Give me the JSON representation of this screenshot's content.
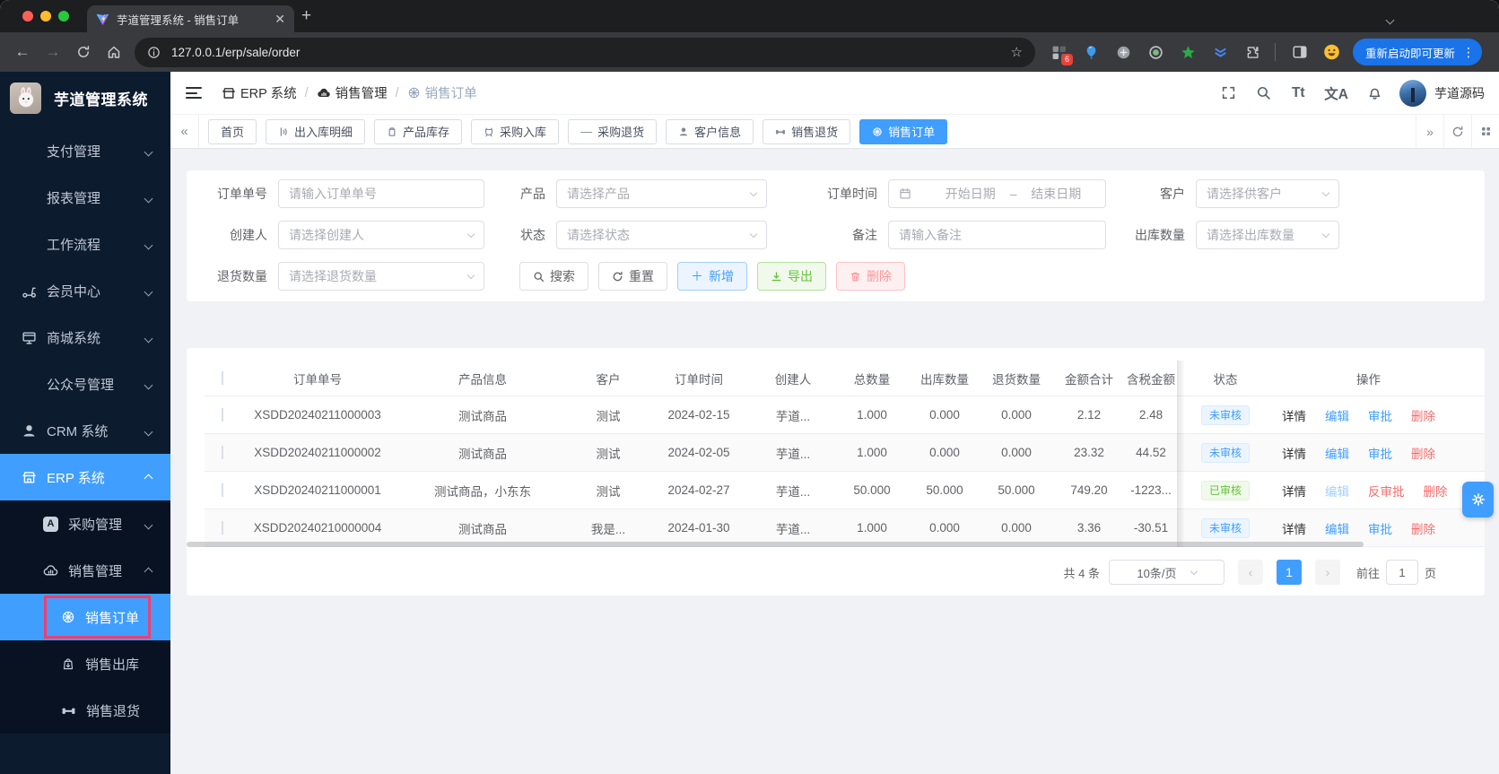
{
  "browser": {
    "tab_title": "芋道管理系统 - 销售订单",
    "url": "127.0.0.1/erp/sale/order",
    "update_label": "重新启动即可更新",
    "ext_badge": "6"
  },
  "sidebar": {
    "logo_title": "芋道管理系统",
    "items": [
      {
        "label": "支付管理"
      },
      {
        "label": "报表管理"
      },
      {
        "label": "工作流程"
      },
      {
        "label": "会员中心"
      },
      {
        "label": "商城系统"
      },
      {
        "label": "公众号管理"
      },
      {
        "label": "CRM 系统"
      },
      {
        "label": "ERP 系统"
      },
      {
        "label": "采购管理"
      },
      {
        "label": "销售管理"
      },
      {
        "label": "销售订单"
      },
      {
        "label": "销售出库"
      },
      {
        "label": "销售退货"
      }
    ]
  },
  "header": {
    "breadcrumb": [
      {
        "label": "ERP 系统"
      },
      {
        "label": "销售管理"
      },
      {
        "label": "销售订单"
      }
    ],
    "font_button": "Tt",
    "lang_button": "文A",
    "username": "芋道源码"
  },
  "tabs": [
    {
      "label": "首页"
    },
    {
      "label": "出入库明细"
    },
    {
      "label": "产品库存"
    },
    {
      "label": "采购入库"
    },
    {
      "label": "采购退货"
    },
    {
      "label": "客户信息"
    },
    {
      "label": "销售退货"
    },
    {
      "label": "销售订单"
    }
  ],
  "filters": {
    "order_no": {
      "label": "订单单号",
      "placeholder": "请输入订单单号"
    },
    "product": {
      "label": "产品",
      "placeholder": "请选择产品"
    },
    "order_time": {
      "label": "订单时间",
      "start": "开始日期",
      "separator": "–",
      "end": "结束日期"
    },
    "customer": {
      "label": "客户",
      "placeholder": "请选择供客户"
    },
    "creator": {
      "label": "创建人",
      "placeholder": "请选择创建人"
    },
    "status": {
      "label": "状态",
      "placeholder": "请选择状态"
    },
    "remark": {
      "label": "备注",
      "placeholder": "请输入备注"
    },
    "out_count": {
      "label": "出库数量",
      "placeholder": "请选择出库数量"
    },
    "return_count": {
      "label": "退货数量",
      "placeholder": "请选择退货数量"
    }
  },
  "toolbar": {
    "search_label": "搜索",
    "reset_label": "重置",
    "add_label": "新增",
    "export_label": "导出",
    "delete_label": "删除"
  },
  "table": {
    "columns": [
      "订单单号",
      "产品信息",
      "客户",
      "订单时间",
      "创建人",
      "总数量",
      "出库数量",
      "退货数量",
      "金额合计",
      "含税金额",
      "状态",
      "操作"
    ],
    "rows": [
      {
        "order_no": "XSDD20240211000003",
        "product": "测试商品",
        "customer": "测试",
        "time": "2024-02-15",
        "creator": "芋道...",
        "total": "1.000",
        "out": "0.000",
        "ret": "0.000",
        "amount": "2.12",
        "tax": "2.48",
        "status": "未审核",
        "actions": [
          "详情",
          "编辑",
          "审批",
          "删除"
        ]
      },
      {
        "order_no": "XSDD20240211000002",
        "product": "测试商品",
        "customer": "测试",
        "time": "2024-02-05",
        "creator": "芋道...",
        "total": "1.000",
        "out": "0.000",
        "ret": "0.000",
        "amount": "23.32",
        "tax": "44.52",
        "status": "未审核",
        "actions": [
          "详情",
          "编辑",
          "审批",
          "删除"
        ]
      },
      {
        "order_no": "XSDD20240211000001",
        "product": "测试商品，小东东",
        "customer": "测试",
        "time": "2024-02-27",
        "creator": "芋道...",
        "total": "50.000",
        "out": "50.000",
        "ret": "50.000",
        "amount": "749.20",
        "tax": "-1223...",
        "status": "已审核",
        "actions": [
          "详情",
          "编辑",
          "反审批",
          "删除"
        ]
      },
      {
        "order_no": "XSDD20240210000004",
        "product": "测试商品",
        "customer": "我是...",
        "time": "2024-01-30",
        "creator": "芋道...",
        "total": "1.000",
        "out": "0.000",
        "ret": "0.000",
        "amount": "3.36",
        "tax": "-30.51",
        "status": "未审核",
        "actions": [
          "详情",
          "编辑",
          "审批",
          "删除"
        ]
      }
    ]
  },
  "pagination": {
    "total": "共 4 条",
    "page_size": "10条/页",
    "page": "1",
    "goto_label": "前往",
    "goto_value": "1",
    "unit": "页"
  },
  "colors": {
    "accent": "#409eff",
    "success": "#67c23a",
    "danger": "#f56c6c",
    "sidebar_bg": "#0d1b2e",
    "highlight_border": "#f23d6b",
    "status_unapproved_bg": "#ecf5ff",
    "status_approved_bg": "#f0f9eb"
  }
}
